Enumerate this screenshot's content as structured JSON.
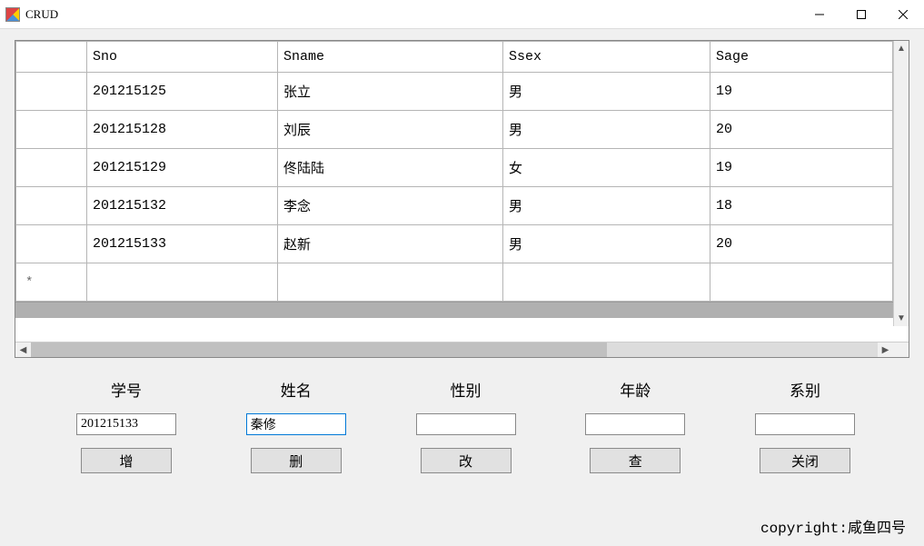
{
  "window": {
    "title": "CRUD"
  },
  "grid": {
    "headers": {
      "sno": "Sno",
      "sname": "Sname",
      "ssex": "Ssex",
      "sage": "Sage"
    },
    "rows": [
      {
        "sno": "201215125",
        "sname": "张立",
        "ssex": "男",
        "sage": "19"
      },
      {
        "sno": "201215128",
        "sname": "刘辰",
        "ssex": "男",
        "sage": "20"
      },
      {
        "sno": "201215129",
        "sname": "佟陆陆",
        "ssex": "女",
        "sage": "19"
      },
      {
        "sno": "201215132",
        "sname": "李念",
        "ssex": "男",
        "sage": "18"
      },
      {
        "sno": "201215133",
        "sname": "赵新",
        "ssex": "男",
        "sage": "20"
      }
    ],
    "newrow_marker": "*"
  },
  "form": {
    "labels": {
      "sno": "学号",
      "sname": "姓名",
      "ssex": "性别",
      "sage": "年龄",
      "sdept": "系别"
    },
    "values": {
      "sno": "201215133",
      "sname": "秦修",
      "ssex": "",
      "sage": "",
      "sdept": ""
    },
    "buttons": {
      "add": "增",
      "delete": "删",
      "update": "改",
      "query": "查",
      "close": "关闭"
    }
  },
  "footer": {
    "copyright": "copyright:咸鱼四号"
  }
}
